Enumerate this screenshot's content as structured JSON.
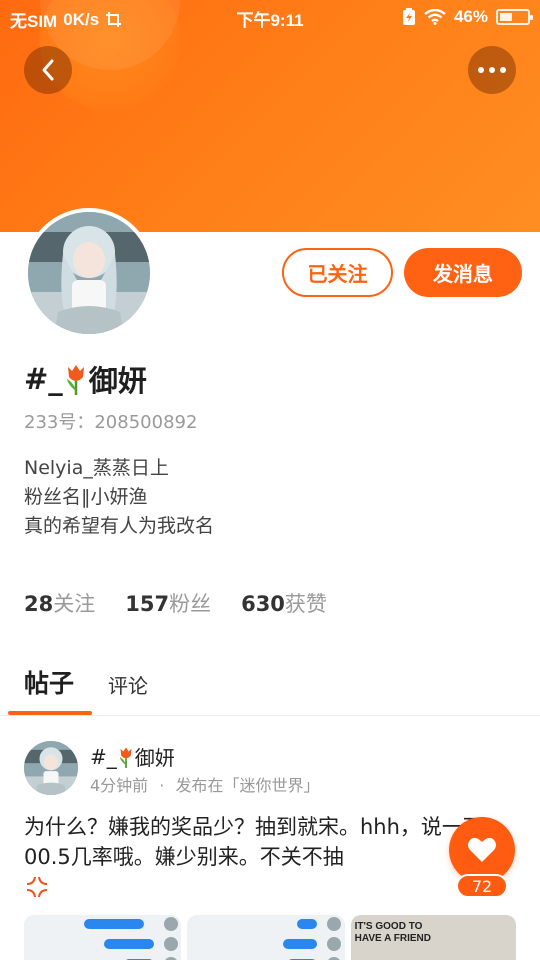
{
  "status_bar": {
    "carrier": "无SIM",
    "network_speed": "0K/s",
    "time": "下午9:11",
    "battery_percent": "46%",
    "battery_level": 0.46
  },
  "colors": {
    "accent": "#ff6212",
    "banner": "#ff7a16"
  },
  "profile": {
    "name_prefix": "#_",
    "name_suffix": "御妍",
    "name_emoji": "tulip-icon",
    "uid": "233号：208500892",
    "bio_lines": [
      "Nelyia_蒸蒸日上",
      "粉丝名‖小妍渔",
      "真的希望有人为我改名"
    ],
    "follow_label": "已关注",
    "message_label": "发消息"
  },
  "stats": [
    {
      "value": "28",
      "label": "关注"
    },
    {
      "value": "157",
      "label": "粉丝"
    },
    {
      "value": "630",
      "label": "获赞"
    }
  ],
  "tabs": [
    {
      "label": "帖子",
      "active": true
    },
    {
      "label": "评论",
      "active": false
    }
  ],
  "post": {
    "author_prefix": "#_",
    "author_suffix": "御妍",
    "time": "4分钟前",
    "separator": "·",
    "published_in": "发布在「迷你世界」",
    "text": "为什么？嫌我的奖品少？抽到就宋。hhh，说一下，00.5几率哦。嫌少别来。不关不抽",
    "like_count": "72",
    "image3_lines": [
      "IT'S GOOD TO",
      "HAVE A FRIEND"
    ]
  }
}
